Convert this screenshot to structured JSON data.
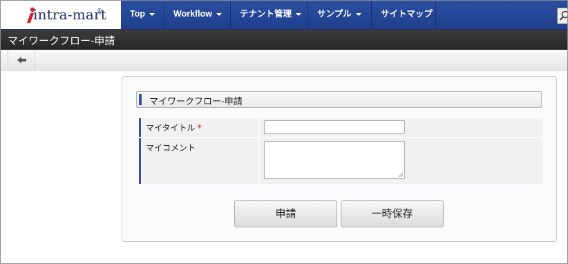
{
  "brand": {
    "logo_text": "intra-mart",
    "logo_mark": "®"
  },
  "nav": {
    "items": [
      {
        "label": "Top",
        "has_caret": true
      },
      {
        "label": "Workflow",
        "has_caret": true
      },
      {
        "label": "テナント管理",
        "has_caret": true
      },
      {
        "label": "サンプル",
        "has_caret": true
      },
      {
        "label": "サイトマップ",
        "has_caret": false
      }
    ]
  },
  "page": {
    "title": "マイワークフロー-申請"
  },
  "toolbar": {
    "back_icon": "arrow-left-icon"
  },
  "form": {
    "section_title": "マイワークフロー-申請",
    "fields": [
      {
        "label": "マイタイトル",
        "required_mark": "*",
        "value": ""
      },
      {
        "label": "マイコメント",
        "value": ""
      }
    ]
  },
  "actions": {
    "apply_label": "申請",
    "save_label": "一時保存"
  },
  "colors": {
    "nav_bg": "#2a4ea0",
    "title_bar_bg": "#2f2f2f",
    "accent_bar": "#3651a0",
    "required": "#cc1111"
  }
}
